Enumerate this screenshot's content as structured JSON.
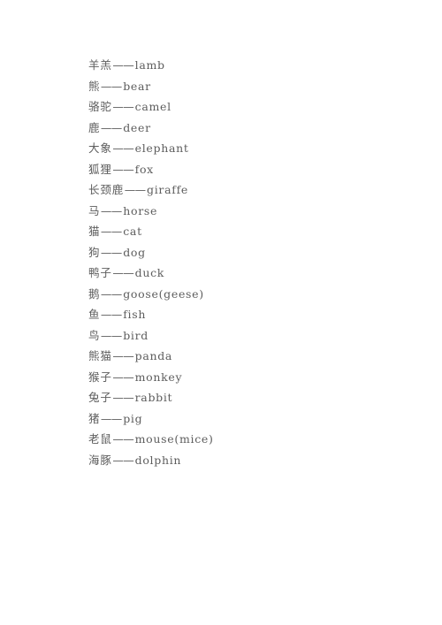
{
  "document": {
    "page_background": "#ffffff",
    "text_color": "#5d5d5d",
    "separator": "——"
  },
  "vocab_list": [
    {
      "chinese": "羊羔",
      "english": "lamb"
    },
    {
      "chinese": "熊",
      "english": "bear"
    },
    {
      "chinese": "骆驼",
      "english": "camel"
    },
    {
      "chinese": "鹿",
      "english": "deer"
    },
    {
      "chinese": "大象",
      "english": "elephant"
    },
    {
      "chinese": "狐狸",
      "english": "fox"
    },
    {
      "chinese": "长颈鹿",
      "english": "giraffe"
    },
    {
      "chinese": "马",
      "english": "horse"
    },
    {
      "chinese": "猫",
      "english": "cat"
    },
    {
      "chinese": "狗",
      "english": "dog"
    },
    {
      "chinese": "鸭子",
      "english": "duck"
    },
    {
      "chinese": "鹅",
      "english": "goose(geese)"
    },
    {
      "chinese": "鱼",
      "english": "fish"
    },
    {
      "chinese": "鸟",
      "english": "bird"
    },
    {
      "chinese": "熊猫",
      "english": "panda"
    },
    {
      "chinese": "猴子",
      "english": "monkey"
    },
    {
      "chinese": "兔子",
      "english": "rabbit"
    },
    {
      "chinese": "猪",
      "english": "pig"
    },
    {
      "chinese": "老鼠",
      "english": "mouse(mice)"
    },
    {
      "chinese": "海豚",
      "english": "dolphin"
    }
  ]
}
